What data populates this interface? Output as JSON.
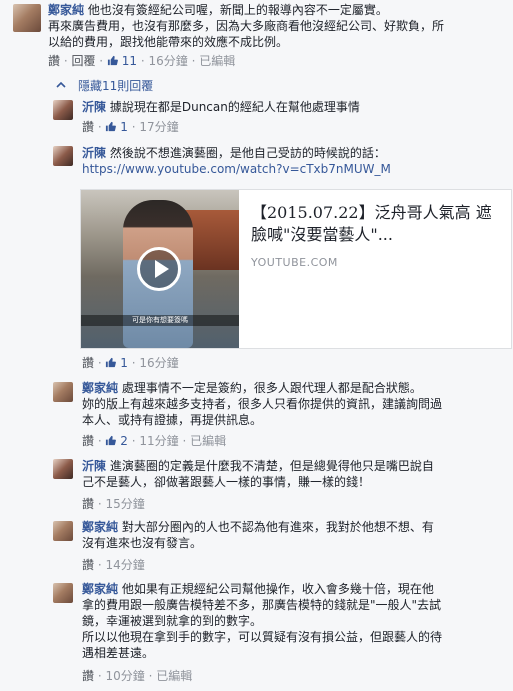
{
  "comments": [
    {
      "author": "鄭家純",
      "text": "他也沒有簽經紀公司喔，新聞上的報導內容不一定屬實。",
      "text2": "再來廣告費用，也沒有那麼多，因為大多廠商看他沒經紀公司、好欺負，所",
      "text3": "以給的費用，跟找他能帶來的效應不成比例。",
      "actions": {
        "like": "讚",
        "reply": "回覆",
        "likes": "11",
        "time": "16分鐘",
        "edited": "已編輯"
      }
    },
    {
      "author": "沂陳",
      "text": "據說現在都是Duncan的經紀人在幫他處理事情",
      "actions": {
        "like": "讚",
        "likes": "1",
        "time": "17分鐘"
      }
    },
    {
      "author": "沂陳",
      "text": "然後說不想進演藝圈，是他自己受訪的時候說的話：",
      "link": "https://www.youtube.com/watch?v=cTxb7nMUW_M",
      "actions": {
        "like": "讚",
        "likes": "1",
        "time": "16分鐘"
      }
    },
    {
      "author": "鄭家純",
      "text": "處理事情不一定是簽約，很多人跟代理人都是配合狀態。",
      "text2": "妳的版上有越來越多支持者，很多人只看你提供的資訊，建議詢問過",
      "text3": "本人、或持有證據，再提供訊息。",
      "actions": {
        "like": "讚",
        "likes": "2",
        "time": "11分鐘",
        "edited": "已編輯"
      }
    },
    {
      "author": "沂陳",
      "text": "進演藝圈的定義是什麼我不清楚，但是總覺得他只是嘴巴說自",
      "text2": "己不是藝人，卻做著跟藝人一樣的事情，賺一樣的錢！",
      "actions": {
        "like": "讚",
        "time": "15分鐘"
      }
    },
    {
      "author": "鄭家純",
      "text": "對大部分圈內的人也不認為他有進來，我對於他想不想、有",
      "text2": "沒有進來也沒有發言。",
      "actions": {
        "like": "讚",
        "time": "14分鐘"
      }
    },
    {
      "author": "鄭家純",
      "text": "他如果有正規經紀公司幫他操作，收入會多幾十倍，現在他",
      "text2": "拿的費用跟一般廣告模特差不多，那廣告模特的錢就是\"一般人\"去試",
      "text3": "鏡，幸運被選到就拿的到的數字。",
      "text4": "所以以他現在拿到手的數字，可以質疑有沒有損公益，但跟藝人的待",
      "text5": "遇相差甚遠。",
      "actions": {
        "like": "讚",
        "time": "10分鐘",
        "edited": "已編輯"
      }
    }
  ],
  "hidden_replies": "隱藏11則回覆",
  "preview": {
    "title": "【2015.07.22】泛舟哥人氣高 遮臉喊\"沒要當藝人\"...",
    "domain": "YOUTUBE.COM",
    "caption": "可是你有想要簽嗎"
  },
  "icons": {
    "thumb": "thumbs-up-icon",
    "caret": "chevron-up-icon",
    "play": "play-icon"
  },
  "colors": {
    "link": "#365899",
    "meta": "#90949c",
    "background": "#f6f7f9"
  }
}
